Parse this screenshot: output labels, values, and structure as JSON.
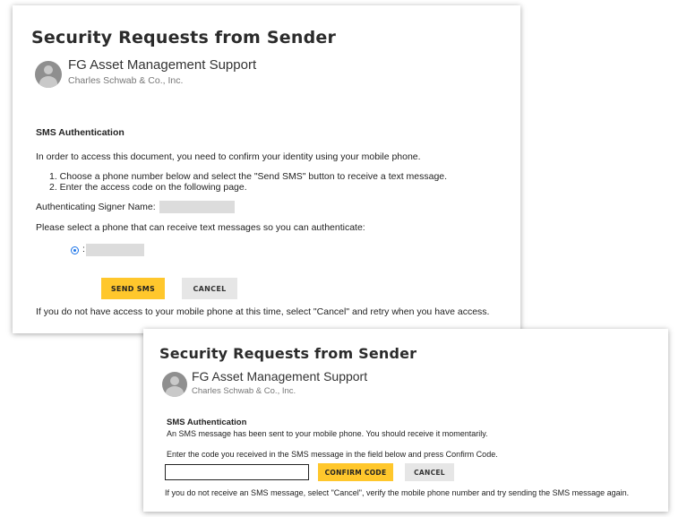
{
  "top_card": {
    "title": "Security Requests from Sender",
    "sender_name": "FG Asset Management Support",
    "sender_org": "Charles Schwab & Co., Inc.",
    "section_heading": "SMS Authentication",
    "intro": "In order to access this document, you need to confirm your identity using your mobile phone.",
    "steps": [
      "1. Choose a phone number below and select the \"Send SMS\" button to receive a text message.",
      "2. Enter the access code on the following page."
    ],
    "signer_label": "Authenticating Signer Name:",
    "phone_prompt": "Please select a phone that can receive text messages so you can authenticate:",
    "phone_option_prefix": ":",
    "send_label": "SEND SMS",
    "cancel_label": "CANCEL",
    "footer": "If you do not have access to your mobile phone at this time, select \"Cancel\" and retry when you have access."
  },
  "bottom_card": {
    "title": "Security Requests from Sender",
    "sender_name": "FG Asset Management Support",
    "sender_org": "Charles Schwab & Co., Inc.",
    "section_heading": "SMS Authentication",
    "sent_message": "An SMS message has been sent to your mobile phone. You should receive it momentarily.",
    "code_instruction": "Enter the code you received in the SMS message in the field below and press Confirm Code.",
    "code_value": "",
    "confirm_label": "CONFIRM CODE",
    "cancel_label": "CANCEL",
    "footer": "If you do not receive an SMS message, select \"Cancel\", verify the mobile phone number and try sending the SMS message again."
  },
  "colors": {
    "accent_button": "#ffc72c",
    "secondary_button": "#e6e6e6",
    "radio": "#1a73e8"
  },
  "icons": {
    "avatar": "person-avatar-icon",
    "radio": "radio-selected-icon"
  }
}
